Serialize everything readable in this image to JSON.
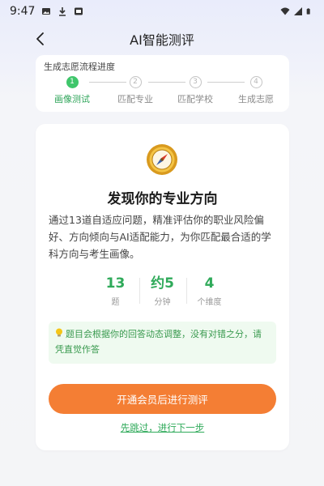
{
  "status_bar": {
    "time": "9:47"
  },
  "header": {
    "title": "AI智能测评"
  },
  "progress": {
    "title": "生成志愿流程进度",
    "steps": [
      {
        "number": "1",
        "label": "画像测试",
        "active": true
      },
      {
        "number": "2",
        "label": "匹配专业",
        "active": false
      },
      {
        "number": "3",
        "label": "匹配学校",
        "active": false
      },
      {
        "number": "4",
        "label": "生成志愿",
        "active": false
      }
    ]
  },
  "intro": {
    "heading": "发现你的专业方向",
    "description": "通过13道自适应问题，精准评估你的职业风险偏好、方向倾向与AI适配能力，为你匹配最合适的学科方向与考生画像。",
    "stats": [
      {
        "value": "13",
        "label": "题"
      },
      {
        "value": "约5",
        "label": "分钟"
      },
      {
        "value": "4",
        "label": "个维度"
      }
    ],
    "tip": "题目会根据你的回答动态调整，没有对错之分，请凭直觉作答",
    "primary_button": "开通会员后进行测评",
    "skip_link": "先跳过，进行下一步"
  },
  "colors": {
    "accent_green": "#2faa5a",
    "step_active": "#3fc66b",
    "primary_orange": "#f47e34",
    "tip_bg": "#effaf0"
  }
}
